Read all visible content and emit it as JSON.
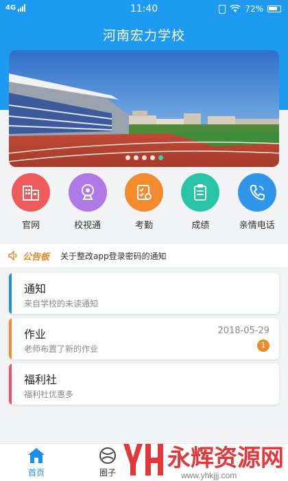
{
  "status_bar": {
    "network": "4G",
    "time": "11:40",
    "battery": "72%"
  },
  "header": {
    "title": "河南宏力学校"
  },
  "banner": {
    "slide_count": 5,
    "active_slide": 5
  },
  "features": [
    {
      "label": "官网",
      "icon": "building-icon",
      "color": "#ef5a5a"
    },
    {
      "label": "校视通",
      "icon": "camera-icon",
      "color": "#b07ae6"
    },
    {
      "label": "考勤",
      "icon": "attendance-icon",
      "color": "#f28a2e"
    },
    {
      "label": "成绩",
      "icon": "clipboard-icon",
      "color": "#28c4a5"
    },
    {
      "label": "亲情电话",
      "icon": "phone-icon",
      "color": "#2f95e9"
    }
  ],
  "notice": {
    "tag": "公告板",
    "text": "关于整改app登录密码的通知"
  },
  "cards": [
    {
      "title": "通知",
      "subtitle": "来自学校的未读通知",
      "accent": "#1d8fe6"
    },
    {
      "title": "作业",
      "subtitle": "老师布置了新的作业",
      "date": "2018-05-29",
      "badge": "1",
      "accent": "#f28a2e"
    },
    {
      "title": "福利社",
      "subtitle": "福利社优惠多",
      "accent": "#e8536b"
    }
  ],
  "tabs": [
    {
      "label": "首页",
      "icon": "home-icon",
      "active": true
    },
    {
      "label": "圈子",
      "icon": "circle-icon",
      "active": false
    }
  ],
  "watermark": {
    "brand": "永辉资源网",
    "url": "www.yhkjjj.com"
  },
  "colors": {
    "primary": "#1d9bf0",
    "accent_orange": "#ef8a2c"
  }
}
